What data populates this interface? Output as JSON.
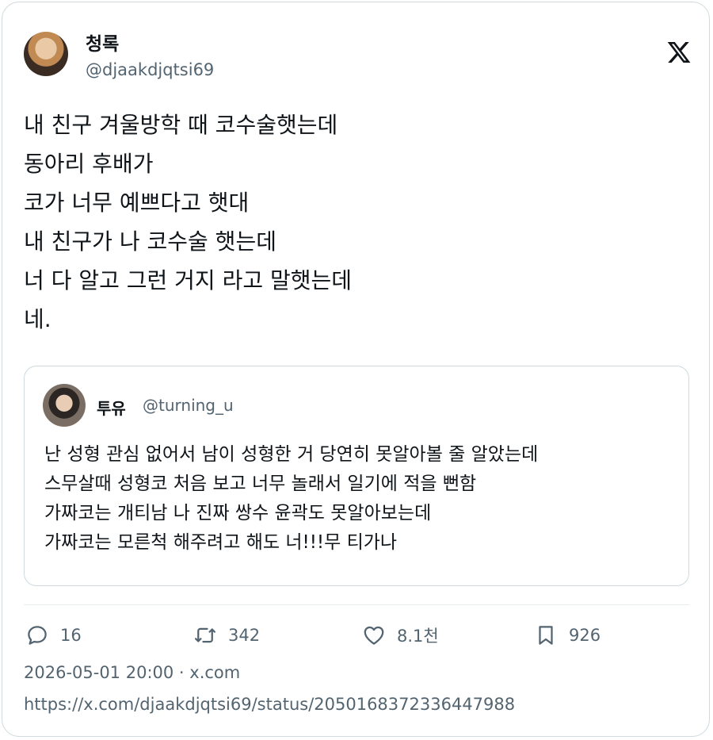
{
  "author": {
    "name": "청록",
    "handle": "@djaakdjqtsi69"
  },
  "tweet": {
    "text": "내 친구 겨울방학 때 코수술햇는데\n동아리 후배가\n코가 너무 예쁘다고 햇대\n내 친구가 나 코수술 햇는데\n너 다 알고 그런 거지 라고 말햇는데\n네."
  },
  "quoted": {
    "name": "투유",
    "handle": "@turning_u",
    "text": "난 성형 관심 없어서 남이 성형한 거 당연히 못알아볼 줄 알았는데\n스무살때 성형코 처음 보고 너무 놀래서 일기에 적을 뻔함\n가짜코는 개티남 나 진짜 쌍수 윤곽도 못알아보는데\n가짜코는 모른척 해주려고 해도 너!!!무 티가나"
  },
  "actions": {
    "reply_count": "16",
    "retweet_count": "342",
    "like_count": "8.1천",
    "bookmark_count": "926"
  },
  "meta": {
    "timestamp": "2026-05-01 20:00",
    "source": " · x.com",
    "url": "https://x.com/djaakdjqtsi69/status/2050168372336447988"
  },
  "icons": {
    "logo": "x-logo-icon",
    "reply": "reply-icon",
    "retweet": "retweet-icon",
    "like": "heart-icon",
    "bookmark": "bookmark-icon"
  },
  "colors": {
    "text": "#0f1419",
    "secondary": "#536471",
    "border": "#cfd9de"
  }
}
